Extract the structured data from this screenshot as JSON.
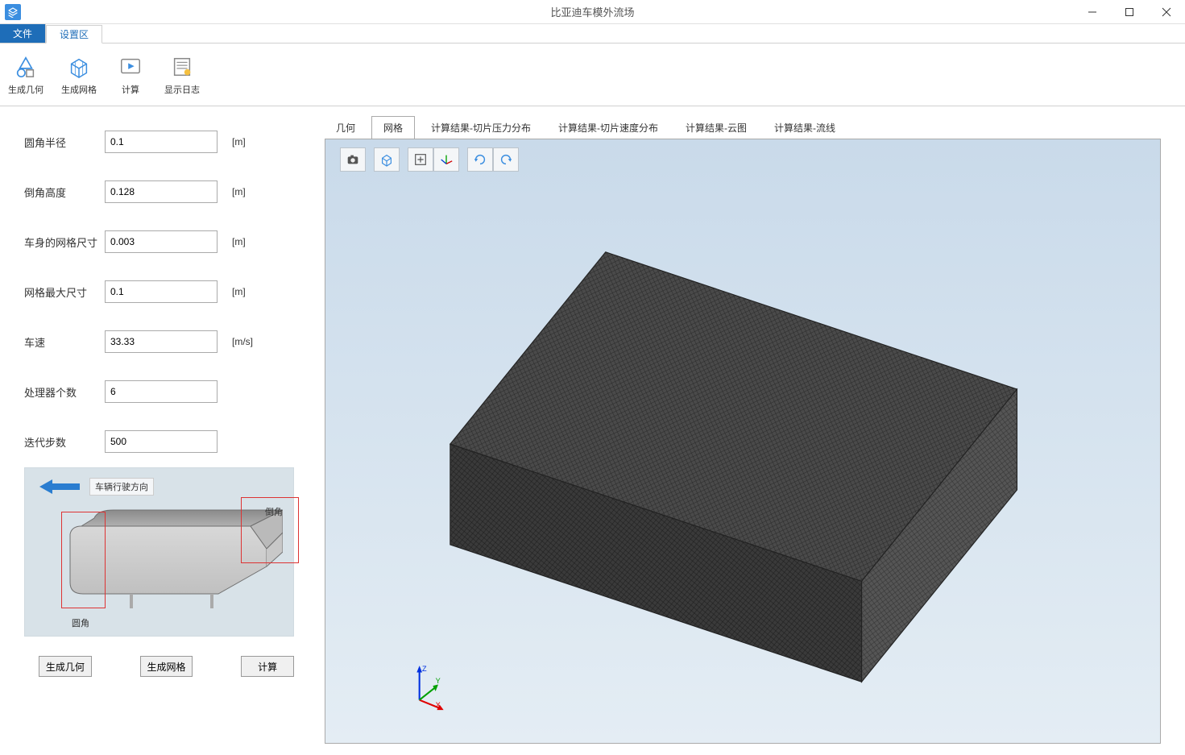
{
  "window": {
    "title": "比亚迪车模外流场"
  },
  "menu": {
    "file": "文件",
    "settings": "设置区"
  },
  "ribbon": {
    "gen_geom": "生成几何",
    "gen_mesh": "生成网格",
    "compute": "计算",
    "show_log": "显示日志"
  },
  "form": {
    "fillet_radius": {
      "label": "圆角半径",
      "value": "0.1",
      "unit": "[m]"
    },
    "chamfer_height": {
      "label": "倒角高度",
      "value": "0.128",
      "unit": "[m]"
    },
    "body_mesh_size": {
      "label": "车身的网格尺寸",
      "value": "0.003",
      "unit": "[m]"
    },
    "mesh_max_size": {
      "label": "网格最大尺寸",
      "value": "0.1",
      "unit": "[m]"
    },
    "vehicle_speed": {
      "label": "车速",
      "value": "33.33",
      "unit": "[m/s]"
    },
    "processor_count": {
      "label": "处理器个数",
      "value": "6",
      "unit": ""
    },
    "iter_steps": {
      "label": "迭代步数",
      "value": "500",
      "unit": ""
    }
  },
  "diagram": {
    "direction_label": "车辆行驶方向",
    "ann_fillet": "圆角",
    "ann_chamfer": "倒角"
  },
  "buttons": {
    "gen_geom": "生成几何",
    "gen_mesh": "生成网格",
    "compute": "计算"
  },
  "view_tabs": {
    "t0": "几何",
    "t1": "网格",
    "t2": "计算结果-切片压力分布",
    "t3": "计算结果-切片速度分布",
    "t4": "计算结果-云图",
    "t5": "计算结果-流线"
  },
  "axis": {
    "x": "X",
    "y": "Y",
    "z": "Z"
  }
}
